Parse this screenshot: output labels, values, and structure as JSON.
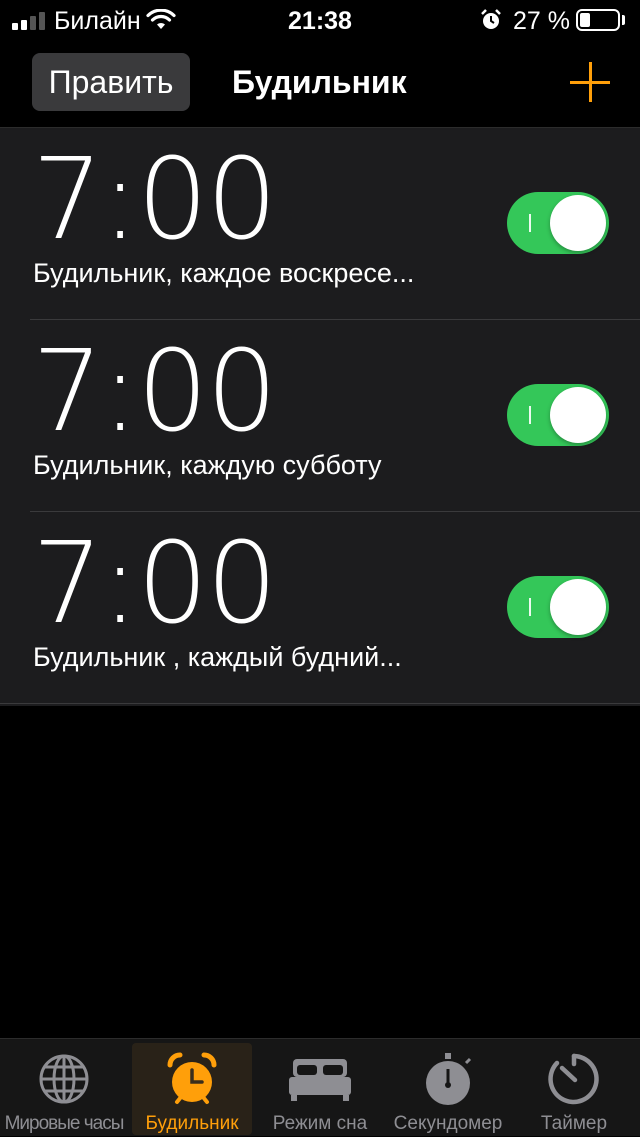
{
  "status_bar": {
    "carrier": "Билайн",
    "time": "21:38",
    "battery_percent": "27 %",
    "battery_level": 0.27,
    "signal_bars": 4,
    "signal_filled": 2
  },
  "nav": {
    "edit_label": "Править",
    "title": "Будильник",
    "add_icon": "plus-icon"
  },
  "alarms": [
    {
      "time": "7:00",
      "label": "Будильник, каждое воскресе...",
      "enabled": true
    },
    {
      "time": "7:00",
      "label": "Будильник, каждую субботу",
      "enabled": true
    },
    {
      "time": "7:00",
      "label": "Будильник , каждый будний...",
      "enabled": true
    }
  ],
  "tabs": [
    {
      "label": "Мировые часы",
      "icon": "globe-icon",
      "active": false
    },
    {
      "label": "Будильник",
      "icon": "alarm-clock-icon",
      "active": true
    },
    {
      "label": "Режим сна",
      "icon": "bed-icon",
      "active": false
    },
    {
      "label": "Секундомер",
      "icon": "stopwatch-icon",
      "active": false
    },
    {
      "label": "Таймер",
      "icon": "timer-icon",
      "active": false
    }
  ],
  "colors": {
    "accent": "#ff9f0a",
    "toggle_on": "#34c759",
    "inactive": "#8e8e93"
  }
}
